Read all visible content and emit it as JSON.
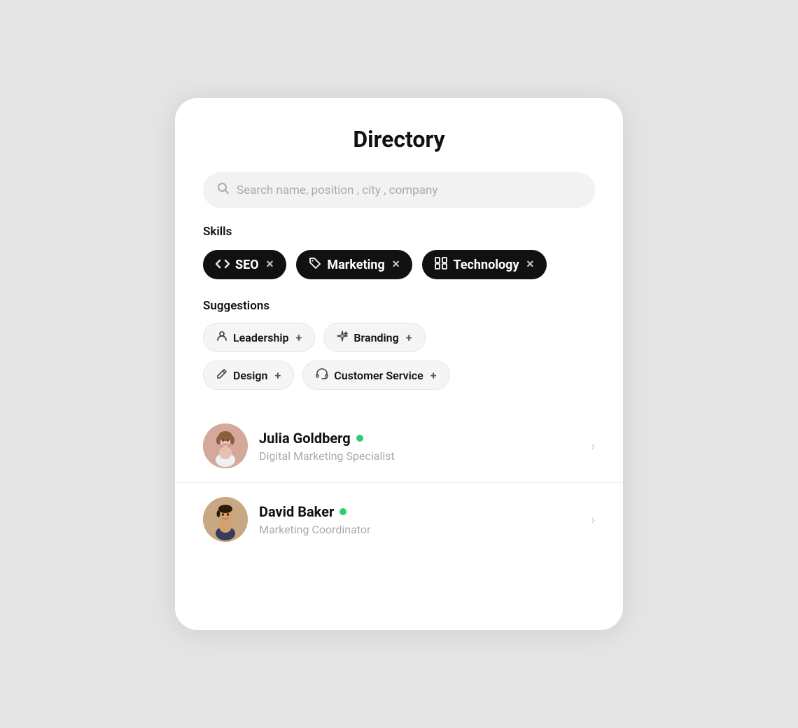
{
  "page": {
    "background": "#e5e5e5"
  },
  "card": {
    "title": "Directory"
  },
  "search": {
    "placeholder": "Search name, position , city , company"
  },
  "skills_section": {
    "label": "Skills",
    "chips": [
      {
        "id": "seo",
        "icon": "</>",
        "label": "SEO",
        "icon_type": "code"
      },
      {
        "id": "marketing",
        "icon": "🏷",
        "label": "Marketing",
        "icon_type": "tag"
      },
      {
        "id": "technology",
        "icon": "⊞",
        "label": "Technology",
        "icon_type": "grid"
      }
    ]
  },
  "suggestions_section": {
    "label": "Suggestions",
    "chips": [
      {
        "id": "leadership",
        "icon": "person",
        "label": "Leadership"
      },
      {
        "id": "branding",
        "icon": "sparkle",
        "label": "Branding"
      },
      {
        "id": "design",
        "icon": "pen",
        "label": "Design"
      },
      {
        "id": "customer-service",
        "icon": "headset",
        "label": "Customer Service"
      }
    ]
  },
  "people": [
    {
      "id": "julia",
      "name": "Julia Goldberg",
      "role": "Digital Marketing Specialist",
      "online": true,
      "avatar_type": "julia"
    },
    {
      "id": "david",
      "name": "David Baker",
      "role": "Marketing Coordinator",
      "online": true,
      "avatar_type": "david"
    }
  ],
  "labels": {
    "close": "×",
    "add": "+",
    "chevron": "›"
  }
}
